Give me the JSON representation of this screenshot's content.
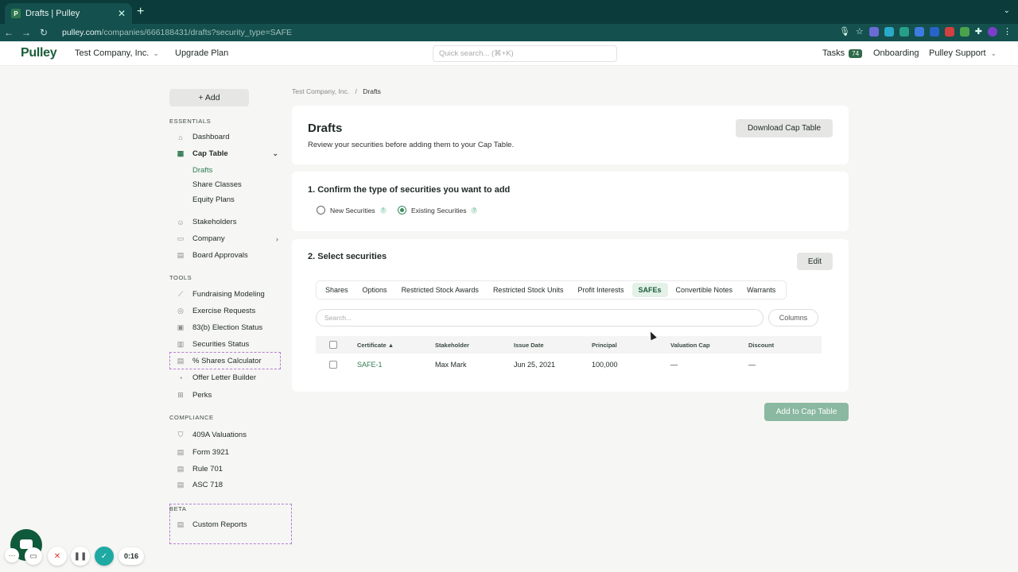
{
  "browser": {
    "tab_title": "Drafts | Pulley",
    "favicon_letter": "P",
    "url_host": "pulley.com",
    "url_path": "/companies/666188431/drafts?security_type=SAFE"
  },
  "header": {
    "logo": "Pulley",
    "company": "Test Company, Inc.",
    "upgrade": "Upgrade Plan",
    "quick_search_placeholder": "Quick search... (⌘+K)",
    "tasks_label": "Tasks",
    "tasks_count": "74",
    "onboarding": "Onboarding",
    "support": "Pulley Support"
  },
  "sidebar": {
    "add_label": "+ Add",
    "essentials_label": "ESSENTIALS",
    "tools_label": "TOOLS",
    "compliance_label": "COMPLIANCE",
    "beta_label": "BETA",
    "essentials": [
      {
        "label": "Dashboard",
        "icon": "home-icon"
      },
      {
        "label": "Cap Table",
        "icon": "table-icon"
      },
      {
        "label": "Stakeholders",
        "icon": "users-icon"
      },
      {
        "label": "Company",
        "icon": "building-icon"
      },
      {
        "label": "Board Approvals",
        "icon": "document-icon"
      }
    ],
    "cap_table_sub": [
      "Drafts",
      "Share Classes",
      "Equity Plans"
    ],
    "tools": [
      {
        "label": "Fundraising Modeling",
        "icon": "chart-line-icon"
      },
      {
        "label": "Exercise Requests",
        "icon": "exercise-icon"
      },
      {
        "label": "83(b) Election Status",
        "icon": "election-icon"
      },
      {
        "label": "Securities Status",
        "icon": "bar-chart-icon"
      },
      {
        "label": "% Shares Calculator",
        "icon": "calculator-icon"
      },
      {
        "label": "Offer Letter Builder",
        "icon": "palette-icon"
      },
      {
        "label": "Perks",
        "icon": "gift-icon"
      }
    ],
    "compliance": [
      {
        "label": "409A Valuations",
        "icon": "shield-icon"
      },
      {
        "label": "Form 3921",
        "icon": "document-icon"
      },
      {
        "label": "Rule 701",
        "icon": "document-icon"
      },
      {
        "label": "ASC 718",
        "icon": "document-icon"
      }
    ],
    "beta": [
      {
        "label": "Custom Reports",
        "icon": "report-icon"
      }
    ]
  },
  "main": {
    "breadcrumb_root": "Test Company, Inc.",
    "breadcrumb_sep": "/",
    "breadcrumb_current": "Drafts",
    "title": "Drafts",
    "description": "Review your securities before adding them to your Cap Table.",
    "download_button": "Download Cap Table",
    "step1_title": "1. Confirm the type of securities you want to add",
    "radio_new": "New Securities",
    "radio_existing": "Existing Securities",
    "step2_title": "2. Select securities",
    "edit_button": "Edit",
    "security_tabs": [
      "Shares",
      "Options",
      "Restricted Stock Awards",
      "Restricted Stock Units",
      "Profit Interests",
      "SAFEs",
      "Convertible Notes",
      "Warrants"
    ],
    "active_tab": "SAFEs",
    "search_placeholder": "Search...",
    "columns_button": "Columns",
    "table": {
      "headers": [
        "Certificate",
        "Stakeholder",
        "Issue Date",
        "Principal",
        "Valuation Cap",
        "Discount"
      ],
      "sort_indicator": "▲",
      "rows": [
        {
          "certificate": "SAFE-1",
          "stakeholder": "Max Mark",
          "issue_date": "Jun 25, 2021",
          "principal": "100,000",
          "valuation_cap": "—",
          "discount": "—"
        }
      ]
    },
    "add_to_cap_table": "Add to Cap Table"
  },
  "recorder": {
    "timer": "0:16"
  },
  "colors": {
    "brand_green": "#1b5e3a",
    "accent_green": "#2f7a4f",
    "chrome_bg": "#0b3b3a",
    "disabled_button": "#8ab8a0"
  }
}
